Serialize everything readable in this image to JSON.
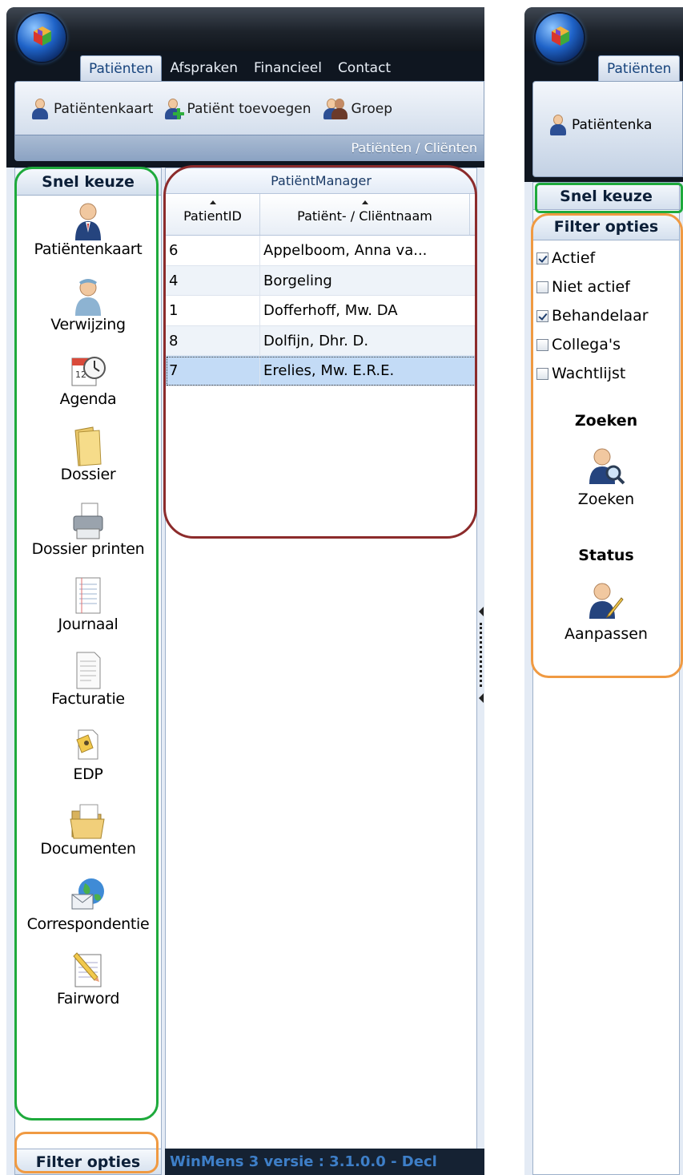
{
  "window1": {
    "tabs": [
      "Patiënten",
      "Afspraken",
      "Financieel",
      "Contact"
    ],
    "ribbon_buttons": [
      "Patiëntenkaart",
      "Patiënt toevoegen",
      "Groep"
    ],
    "ribbon_group_label": "Patiënten / Cliënten",
    "snel_keuze_header": "Snel keuze",
    "nav_items": [
      {
        "label": "Patiëntenkaart",
        "icon": "patient-card-icon"
      },
      {
        "label": "Verwijzing",
        "icon": "nurse-icon"
      },
      {
        "label": "Agenda",
        "icon": "calendar-clock-icon"
      },
      {
        "label": "Dossier",
        "icon": "folder-icon"
      },
      {
        "label": "Dossier printen",
        "icon": "printer-icon"
      },
      {
        "label": "Journaal",
        "icon": "journal-icon"
      },
      {
        "label": "Facturatie",
        "icon": "invoice-document-icon"
      },
      {
        "label": "EDP",
        "icon": "edp-icon"
      },
      {
        "label": "Documenten",
        "icon": "open-folder-icon"
      },
      {
        "label": "Correspondentie",
        "icon": "globe-mail-icon"
      },
      {
        "label": "Fairword",
        "icon": "notepad-pencil-icon"
      }
    ],
    "grid": {
      "title": "PatiëntManager",
      "columns": [
        "PatientID",
        "Patiënt- / Cliëntnaam"
      ],
      "rows": [
        {
          "id": "6",
          "name": "Appelboom, Anna va..."
        },
        {
          "id": "4",
          "name": "Borgeling"
        },
        {
          "id": "1",
          "name": "Dofferhoff, Mw. DA"
        },
        {
          "id": "8",
          "name": "Dolfijn, Dhr. D."
        },
        {
          "id": "7",
          "name": "Erelies, Mw. E.R.E."
        }
      ],
      "selected_row": 4
    },
    "filter_opties_bar": "Filter opties",
    "status_text": "WinMens 3 versie : 3.1.0.0 - Decl"
  },
  "window2": {
    "tab": "Patiënten",
    "ribbon_button": "Patiëntenka",
    "snel_keuze_header": "Snel keuze",
    "filter_header": "Filter opties",
    "filters": [
      {
        "label": "Actief",
        "checked": true
      },
      {
        "label": "Niet actief",
        "checked": false
      },
      {
        "label": "Behandelaar",
        "checked": true
      },
      {
        "label": "Collega's",
        "checked": false
      },
      {
        "label": "Wachtlijst",
        "checked": false
      }
    ],
    "zoeken_section": "Zoeken",
    "zoeken_button": "Zoeken",
    "status_section": "Status",
    "aanpassen_button": "Aanpassen"
  },
  "annotation_colors": {
    "snel_keuze": "#1eaa3c",
    "grid": "#8c2b2b",
    "filter_opties": "#f09a42"
  }
}
